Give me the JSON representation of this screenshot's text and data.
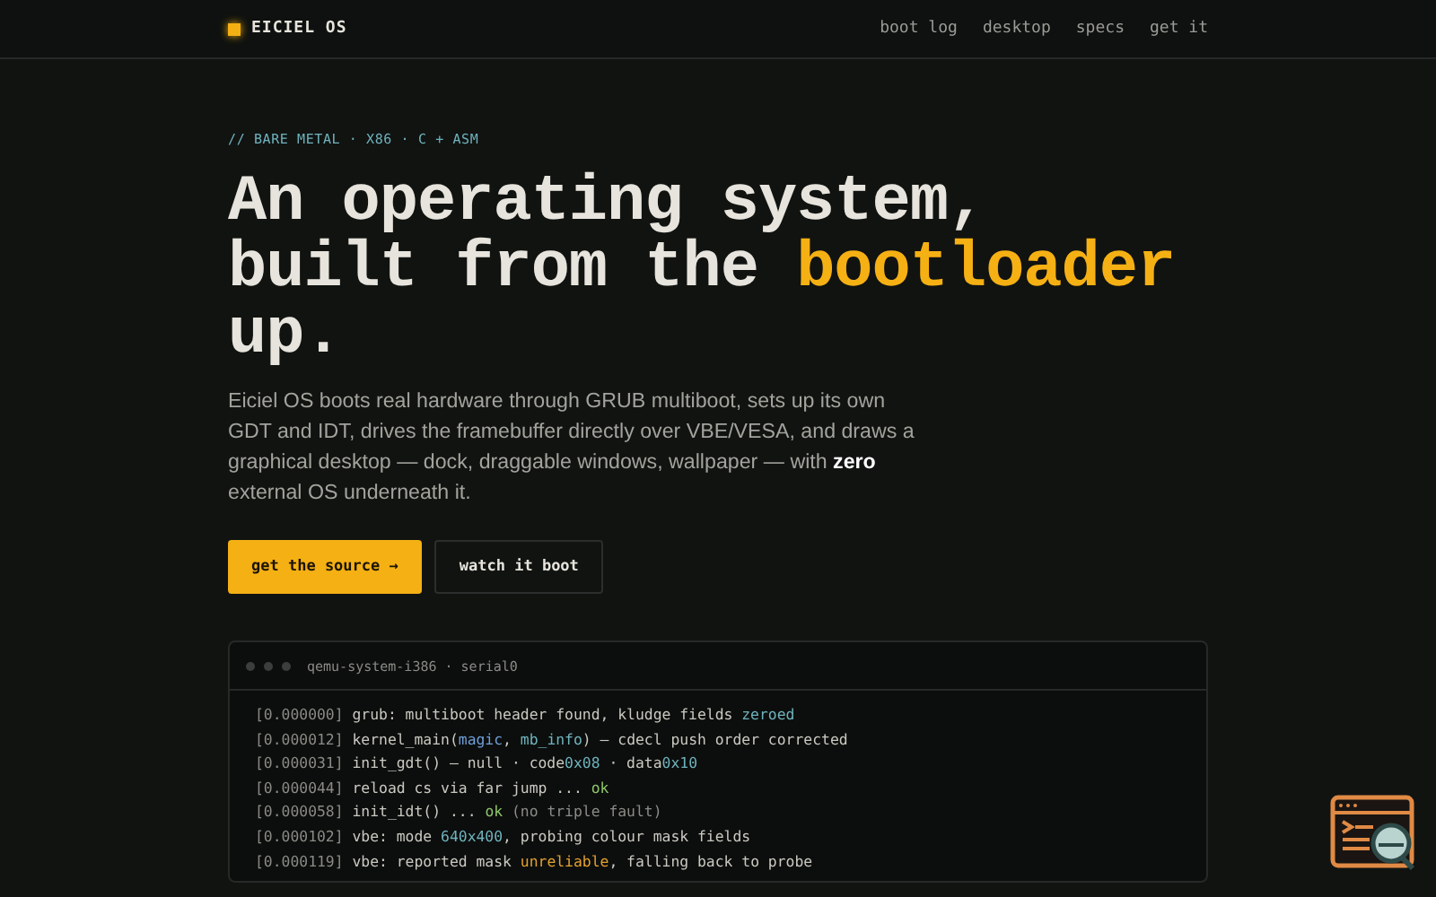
{
  "header": {
    "brand": "EICIEL OS",
    "nav": [
      {
        "label": "boot log"
      },
      {
        "label": "desktop"
      },
      {
        "label": "specs"
      },
      {
        "label": "get it"
      }
    ]
  },
  "hero": {
    "eyebrow": "// BARE METAL · X86 · C + ASM",
    "title": [
      {
        "text": "An operating system,",
        "kind": "plain"
      },
      {
        "text": "built from the ",
        "kind": "plain"
      },
      {
        "text": "bootloader",
        "kind": "accent"
      },
      {
        "text": "up.",
        "kind": "plain"
      }
    ],
    "description": "Eiciel OS boots real hardware through GRUB multiboot, sets up its own GDT and IDT, drives the framebuffer directly over VBE/VESA, and draws a graphical desktop — dock, draggable windows, wallpaper — with **zero** external OS underneath it.",
    "buttons": [
      {
        "label": "get the source →",
        "kind": "primary"
      },
      {
        "label": "watch it boot",
        "kind": "secondary"
      }
    ]
  },
  "terminal": {
    "title": "qemu-system-i386 · serial0",
    "lines": [
      {
        "time": "[0.000000]",
        "parts": [
          {
            "text": "grub: multiboot header found, kludge fields ",
            "kind": "plain"
          },
          {
            "text": "zeroed",
            "kind": "value"
          }
        ]
      },
      {
        "time": "[0.000012]",
        "parts": [
          {
            "text": "kernel_main(",
            "kind": "plain"
          },
          {
            "text": "magic",
            "kind": "arg"
          },
          {
            "text": ", ",
            "kind": "plain"
          },
          {
            "text": "mb_info",
            "kind": "value"
          },
          {
            "text": ") — cdecl push order corrected",
            "kind": "plain"
          }
        ]
      },
      {
        "time": "[0.000031]",
        "parts": [
          {
            "text": "init_gdt() — null · code",
            "kind": "plain"
          },
          {
            "text": "0x08",
            "kind": "value"
          },
          {
            "text": " · data",
            "kind": "plain"
          },
          {
            "text": "0x10",
            "kind": "value"
          }
        ]
      },
      {
        "time": "[0.000044]",
        "parts": [
          {
            "text": "reload cs via far jump ... ",
            "kind": "plain"
          },
          {
            "text": "ok",
            "kind": "ok"
          }
        ]
      },
      {
        "time": "[0.000058]",
        "parts": [
          {
            "text": "init_idt() ... ",
            "kind": "plain"
          },
          {
            "text": "ok",
            "kind": "ok"
          },
          {
            "text": " (no triple fault)",
            "kind": "dim"
          }
        ]
      },
      {
        "time": "[0.000102]",
        "parts": [
          {
            "text": "vbe: mode ",
            "kind": "plain"
          },
          {
            "text": "640x400",
            "kind": "value"
          },
          {
            "text": ", probing colour mask fields",
            "kind": "plain"
          }
        ]
      },
      {
        "time": "[0.000119]",
        "parts": [
          {
            "text": "vbe: reported mask ",
            "kind": "plain"
          },
          {
            "text": "unreliable",
            "kind": "warn"
          },
          {
            "text": ", falling back to probe",
            "kind": "plain"
          }
        ]
      }
    ]
  }
}
